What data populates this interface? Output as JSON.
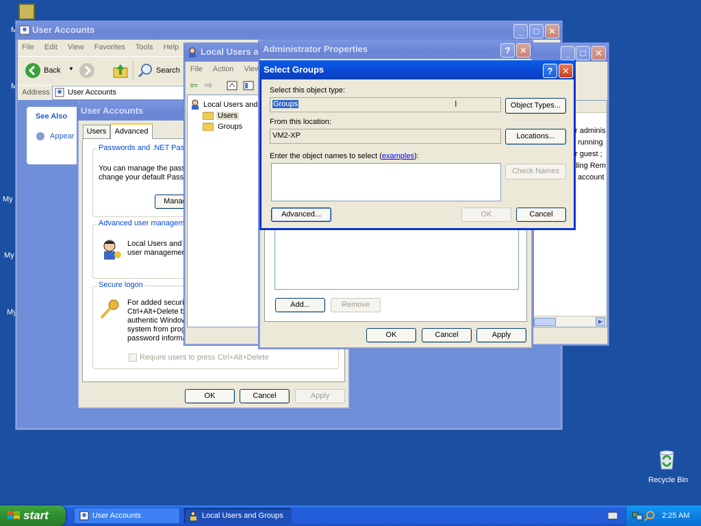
{
  "desktop": {
    "recycle_bin_label": "Recycle Bin",
    "partial_icon_labels": [
      "M",
      "M",
      "My",
      "My",
      "My"
    ]
  },
  "user_accounts_window": {
    "title": "User Accounts",
    "menu": [
      "File",
      "Edit",
      "View",
      "Favorites",
      "Tools",
      "Help"
    ],
    "back_label": "Back",
    "search_label": "Search",
    "address_label": "Address",
    "address_value": "User Accounts",
    "see_also_label": "See Also",
    "appearance_link": "Appear"
  },
  "ua_dialog": {
    "title": "User Accounts",
    "tabs": [
      "Users",
      "Advanced"
    ],
    "passwords_group": "Passwords and .NET Passp",
    "passwords_text": "You can manage the pass\nchange your default Passp",
    "manage_button": "Manag",
    "advanced_group": "Advanced user manageme",
    "advanced_text": "Local Users and G\nuser managemen",
    "secure_group": "Secure logon",
    "secure_text": "For added securit\nCtrl+Alt+Delete b\nauthentic Window\nsystem from prog\npassword informa",
    "ctrl_alt_del_checkbox": "Require users to press Ctrl+Alt+Delete",
    "ok": "OK",
    "cancel": "Cancel",
    "apply": "Apply"
  },
  "lusrmgr_window": {
    "title": "Local Users an",
    "menu": [
      "File",
      "Action",
      "View"
    ],
    "tree_root": "Local Users and G",
    "tree_items": [
      "Users",
      "Groups"
    ],
    "right_text": [
      "r adminis",
      "running",
      "r guest ;",
      "ding Rem",
      "account"
    ]
  },
  "admin_props": {
    "title": "Administrator Properties",
    "add": "Add...",
    "remove": "Remove",
    "ok": "OK",
    "cancel": "Cancel",
    "apply": "Apply"
  },
  "select_groups": {
    "title": "Select Groups",
    "object_type_label": "Select this object type:",
    "object_type_value": "Groups",
    "object_types_button": "Object Types...",
    "location_label": "From this location:",
    "location_value": "VM2-XP",
    "locations_button": "Locations...",
    "names_label": "Enter the object names to select (",
    "names_link": "examples",
    "names_label_end": "):",
    "names_value": "",
    "check_names_button": "Check Names",
    "advanced_button": "Advanced...",
    "ok": "OK",
    "cancel": "Cancel"
  },
  "taskbar": {
    "start_label": "start",
    "tasks": [
      "User Accounts",
      "Local Users and Groups"
    ],
    "clock": "2:25 AM"
  }
}
